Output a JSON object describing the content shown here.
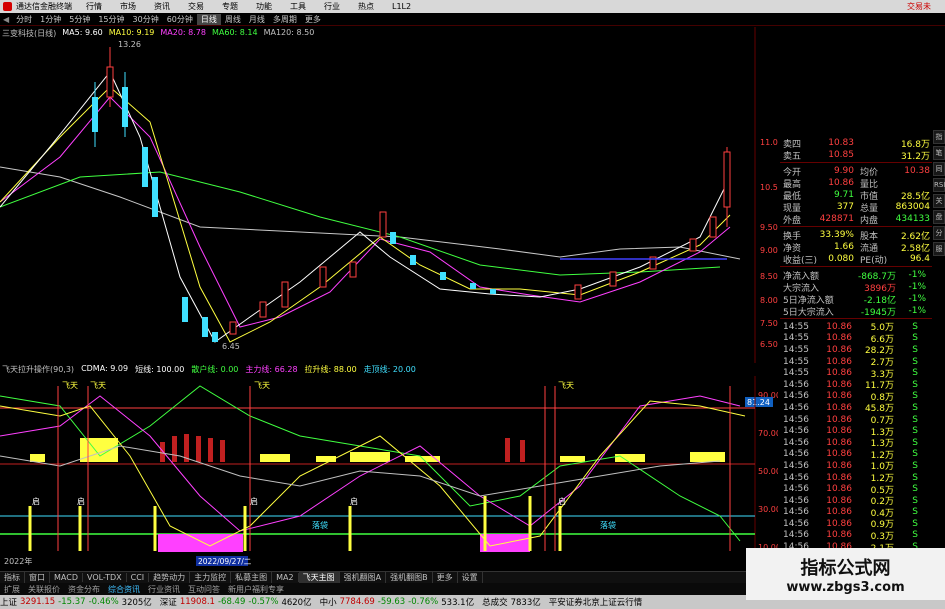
{
  "titlebar": {
    "app_title": "通达信金融终端",
    "menus": [
      "行情",
      "市场",
      "资讯",
      "交易",
      "专题",
      "功能",
      "工具",
      "行业",
      "热点",
      "L1L2"
    ],
    "right_text": "交易未"
  },
  "periods": [
    "分时",
    "1分钟",
    "5分钟",
    "15分钟",
    "30分钟",
    "60分钟",
    "日线",
    "周线",
    "月线",
    "多周期",
    "更多"
  ],
  "active_period": "日线",
  "ma_legend": [
    {
      "label": "三变科技(日线)",
      "color": "#c0c0c0"
    },
    {
      "label": "MA5: 9.60",
      "color": "#ffffff"
    },
    {
      "label": "MA10: 9.19",
      "color": "#ffff40"
    },
    {
      "label": "MA20: 8.78",
      "color": "#ff40ff"
    },
    {
      "label": "MA60: 8.14",
      "color": "#40ff40"
    },
    {
      "label": "MA120: 8.50",
      "color": "#c0c0c0"
    }
  ],
  "price_axis": [
    "11.00",
    "10.50",
    "10.00",
    "9.50",
    "9.00",
    "8.50",
    "8.00",
    "7.50",
    "7.00",
    "6.50"
  ],
  "annotations": {
    "high": "13.26",
    "low": "6.45"
  },
  "sub_legend": [
    {
      "label": "飞天拉升操作(90,3)",
      "color": "#c0c0c0"
    },
    {
      "label": "CDMA: 9.09",
      "color": "#ffffff"
    },
    {
      "label": "短线: 100.00",
      "color": "#ffffff"
    },
    {
      "label": "散户线: 0.00",
      "color": "#40ff40"
    },
    {
      "label": "主力线: 66.28",
      "color": "#ff40ff"
    },
    {
      "label": "拉升线: 88.00",
      "color": "#ffff40"
    },
    {
      "label": "走顶线: 20.00",
      "color": "#40e0ff"
    }
  ],
  "sub_axis": [
    "100.00",
    "90.00",
    "80.00",
    "70.00",
    "60.00",
    "50.00",
    "40.00",
    "30.00",
    "20.00",
    "10.00"
  ],
  "sub_axis_current": "81.24",
  "chart_labels": {
    "feitian": "飞天",
    "qidong": "启",
    "luopan": "落袋",
    "date_marker": "2022/09/27/二",
    "year_label": "2022年"
  },
  "order_book": [
    {
      "label": "卖四",
      "price": "10.83",
      "vol": "16.8万"
    },
    {
      "label": "卖五",
      "price": "10.85",
      "vol": "31.2万"
    }
  ],
  "quote": [
    {
      "l1": "今开",
      "v1": "9.90",
      "c1": "#ff4040",
      "l2": "均价",
      "v2": "10.38",
      "c2": "#ff4040"
    },
    {
      "l1": "最高",
      "v1": "10.86",
      "c1": "#ff4040",
      "l2": "量比",
      "v2": "",
      "c2": "#ff4040"
    },
    {
      "l1": "最低",
      "v1": "9.71",
      "c1": "#40ff40",
      "l2": "市值",
      "v2": "28.5亿",
      "c2": "#ffff40"
    },
    {
      "l1": "现量",
      "v1": "377",
      "c1": "#ffff40",
      "l2": "总量",
      "v2": "863004",
      "c2": "#ffff40"
    },
    {
      "l1": "外盘",
      "v1": "428871",
      "c1": "#ff4040",
      "l2": "内盘",
      "v2": "434133",
      "c2": "#40ff40"
    },
    {
      "l1": "换手",
      "v1": "33.39%",
      "c1": "#ffff40",
      "l2": "股本",
      "v2": "2.62亿",
      "c2": "#ffff40"
    },
    {
      "l1": "净资",
      "v1": "1.66",
      "c1": "#ffff40",
      "l2": "流通",
      "v2": "2.58亿",
      "c2": "#ffff40"
    },
    {
      "l1": "收益(三)",
      "v1": "0.080",
      "c1": "#ffff40",
      "l2": "PE(动)",
      "v2": "96.4",
      "c2": "#ffff40"
    }
  ],
  "fund_flow": [
    {
      "label": "净流入额",
      "value": "-868.7万",
      "color": "#40ff40",
      "pct": "-1%"
    },
    {
      "label": "大宗流入",
      "value": "3896万",
      "color": "#ff4040",
      "pct": "-1%"
    },
    {
      "label": "5日净流入额",
      "value": "-2.18亿",
      "color": "#40ff40",
      "pct": "-1%"
    },
    {
      "label": "5日大宗流入",
      "value": "-1945万",
      "color": "#40ff40",
      "pct": "-1%"
    }
  ],
  "trades": [
    {
      "t": "14:55",
      "p": "10.86",
      "v": "5.0万",
      "d": "S"
    },
    {
      "t": "14:55",
      "p": "10.86",
      "v": "6.6万",
      "d": "S"
    },
    {
      "t": "14:55",
      "p": "10.86",
      "v": "28.2万",
      "d": "S"
    },
    {
      "t": "14:55",
      "p": "10.86",
      "v": "2.7万",
      "d": "S"
    },
    {
      "t": "14:55",
      "p": "10.86",
      "v": "3.3万",
      "d": "S"
    },
    {
      "t": "14:56",
      "p": "10.86",
      "v": "11.7万",
      "d": "S"
    },
    {
      "t": "14:56",
      "p": "10.86",
      "v": "0.8万",
      "d": "S"
    },
    {
      "t": "14:56",
      "p": "10.86",
      "v": "45.8万",
      "d": "S"
    },
    {
      "t": "14:56",
      "p": "10.86",
      "v": "0.7万",
      "d": "S"
    },
    {
      "t": "14:56",
      "p": "10.86",
      "v": "1.3万",
      "d": "S"
    },
    {
      "t": "14:56",
      "p": "10.86",
      "v": "1.3万",
      "d": "S"
    },
    {
      "t": "14:56",
      "p": "10.86",
      "v": "1.2万",
      "d": "S"
    },
    {
      "t": "14:56",
      "p": "10.86",
      "v": "1.0万",
      "d": "S"
    },
    {
      "t": "14:56",
      "p": "10.86",
      "v": "1.2万",
      "d": "S"
    },
    {
      "t": "14:56",
      "p": "10.86",
      "v": "0.5万",
      "d": "S"
    },
    {
      "t": "14:56",
      "p": "10.86",
      "v": "0.2万",
      "d": "S"
    },
    {
      "t": "14:56",
      "p": "10.86",
      "v": "0.4万",
      "d": "S"
    },
    {
      "t": "14:56",
      "p": "10.86",
      "v": "0.9万",
      "d": "S"
    },
    {
      "t": "14:56",
      "p": "10.86",
      "v": "0.3万",
      "d": "S"
    },
    {
      "t": "14:56",
      "p": "10.86",
      "v": "2.1万",
      "d": "S"
    },
    {
      "t": "14:56",
      "p": "10.86",
      "v": "1.1万",
      "d": "S"
    },
    {
      "t": "14:56",
      "p": "10.86",
      "v": "0.3万",
      "d": "S"
    }
  ],
  "side_tabs": [
    "指",
    "笔",
    "同",
    "RSI",
    "关",
    "盘",
    "分",
    "服"
  ],
  "bottom_tabs": [
    "指标",
    "窗口",
    "MACD",
    "VOL-TDX",
    "CCI",
    "趋势动力",
    "主力监控",
    "私募主图",
    "MA2",
    "飞天主图",
    "强机翻图A",
    "强机翻图B",
    "更多",
    "设置"
  ],
  "sub_tabs": [
    "扩展",
    "关联报价",
    "资金分布",
    "综合资讯",
    "行业资讯",
    "互动问答",
    "新用户福利专享"
  ],
  "statusbar": [
    {
      "name": "上证",
      "value": "3291.15",
      "chg": "-15.37",
      "pct": "-0.46%",
      "amt": "3205亿"
    },
    {
      "name": "深证",
      "value": "11908.1",
      "chg": "-68.49",
      "pct": "-0.57%",
      "amt": "4620亿"
    },
    {
      "name": "中小",
      "value": "7784.69",
      "chg": "-59.63",
      "pct": "-0.76%",
      "amt": "533.1亿"
    }
  ],
  "status_extra": {
    "label": "总成交",
    "value": "7833亿",
    "broker": "平安证券北京上证云行情"
  },
  "watermark": {
    "title": "指标公式网",
    "url": "www.zbgs3.com"
  },
  "colors": {
    "up": "#ff4040",
    "down": "#40ff40",
    "accent": "#ffff40",
    "magenta": "#ff40ff"
  }
}
